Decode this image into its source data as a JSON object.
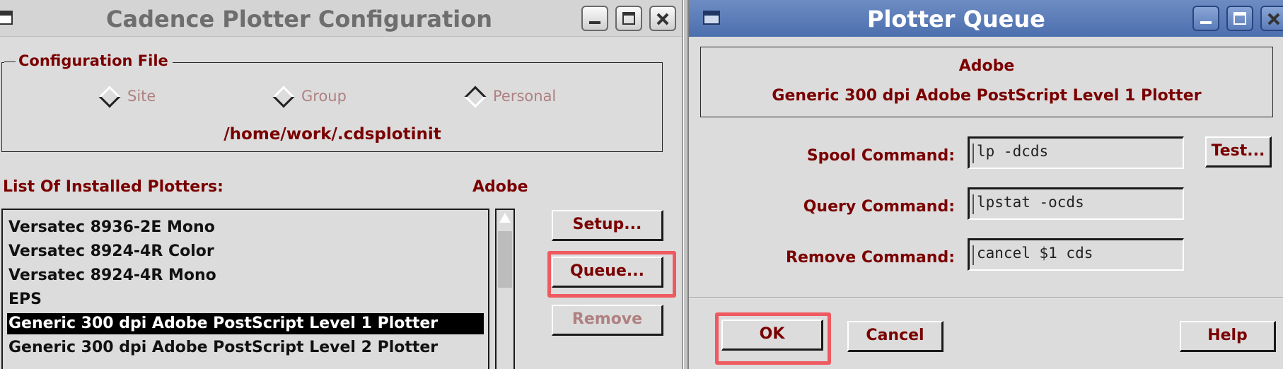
{
  "config_window": {
    "title": "Cadence Plotter Configuration",
    "config_file_group": {
      "label": "Configuration File",
      "options": [
        {
          "label": "Site",
          "selected": false
        },
        {
          "label": "Group",
          "selected": false
        },
        {
          "label": "Personal",
          "selected": true
        }
      ],
      "path": "/home/work/.cdsplotinit"
    },
    "installed_plotters_label": "List Of Installed Plotters:",
    "selected_plotter": "Adobe",
    "plotters": [
      "Versatec 8936-2E Mono",
      "Versatec 8924-4R Color",
      "Versatec 8924-4R Mono",
      "EPS",
      "Generic 300 dpi Adobe PostScript Level 1 Plotter",
      "Generic 300 dpi Adobe PostScript Level 2 Plotter"
    ],
    "selected_index": 4,
    "buttons": {
      "setup": "Setup...",
      "queue": "Queue...",
      "remove": "Remove"
    }
  },
  "queue_window": {
    "title": "Plotter Queue",
    "plotter_name": "Adobe",
    "plotter_description": "Generic 300 dpi Adobe PostScript Level 1 Plotter",
    "fields": {
      "spool": {
        "label": "Spool Command:",
        "value": "lp -dcds"
      },
      "query": {
        "label": "Query Command:",
        "value": "lpstat -ocds"
      },
      "remove": {
        "label": "Remove Command:",
        "value": "cancel $1 cds"
      }
    },
    "buttons": {
      "test": "Test...",
      "ok": "OK",
      "cancel": "Cancel",
      "help": "Help"
    }
  },
  "colors": {
    "label_text": "#7a0000",
    "highlight": "#ee5a60",
    "active_title": "#4c6fae"
  }
}
